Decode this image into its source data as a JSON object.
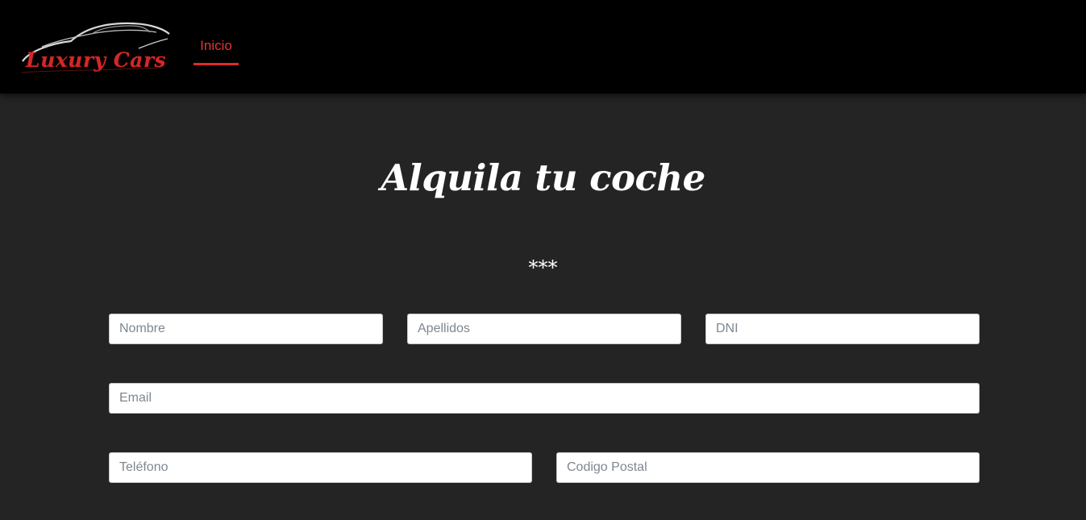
{
  "brand": {
    "name": "Luxury Cars",
    "logo_icon": "car-silhouette-icon",
    "accent_color": "#d42727"
  },
  "nav": {
    "links": [
      {
        "label": "Inicio",
        "active": true
      }
    ]
  },
  "main": {
    "title": "Alquila tu coche",
    "separator": "***"
  },
  "form": {
    "nombre": {
      "placeholder": "Nombre",
      "value": ""
    },
    "apellidos": {
      "placeholder": "Apellidos",
      "value": ""
    },
    "dni": {
      "placeholder": "DNI",
      "value": ""
    },
    "email": {
      "placeholder": "Email",
      "value": ""
    },
    "telefono": {
      "placeholder": "Teléfono",
      "value": ""
    },
    "codigo_postal": {
      "placeholder": "Codigo Postal",
      "value": ""
    }
  }
}
